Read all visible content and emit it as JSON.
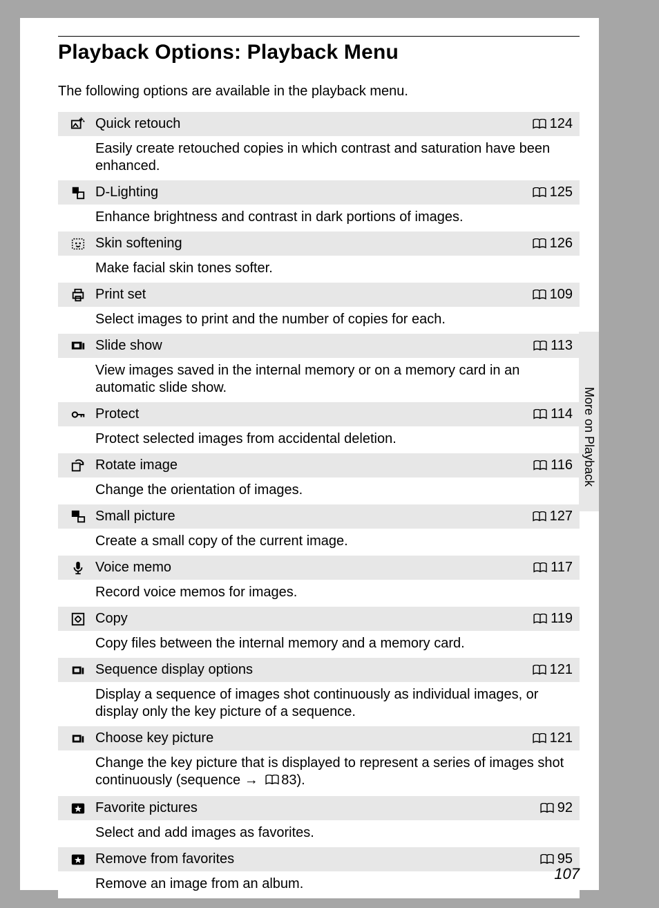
{
  "page_title": "Playback Options: Playback Menu",
  "intro": "The following options are available in the playback menu.",
  "side_label": "More on Playback",
  "page_number": "107",
  "items": [
    {
      "icon": "retouch",
      "title": "Quick retouch",
      "page": "124",
      "desc": "Easily create retouched copies in which contrast and saturation have been enhanced."
    },
    {
      "icon": "dlight",
      "title": "D-Lighting",
      "page": "125",
      "desc": "Enhance brightness and contrast in dark portions of images."
    },
    {
      "icon": "face",
      "title": "Skin softening",
      "page": "126",
      "desc": "Make facial skin tones softer."
    },
    {
      "icon": "printer",
      "title": "Print set",
      "page": "109",
      "desc": "Select images to print and the number of copies for each."
    },
    {
      "icon": "slideshow",
      "title": "Slide show",
      "page": "113",
      "desc": "View images saved in the internal memory or on a memory card in an automatic slide show."
    },
    {
      "icon": "key",
      "title": "Protect",
      "page": "114",
      "desc": "Protect selected images from accidental deletion."
    },
    {
      "icon": "rotate",
      "title": "Rotate image",
      "page": "116",
      "desc": "Change the orientation of images."
    },
    {
      "icon": "small",
      "title": "Small picture",
      "page": "127",
      "desc": "Create a small copy of the current image."
    },
    {
      "icon": "mic",
      "title": "Voice memo",
      "page": "117",
      "desc": "Record voice memos for images."
    },
    {
      "icon": "copy",
      "title": "Copy",
      "page": "119",
      "desc": "Copy files between the internal memory and a memory card."
    },
    {
      "icon": "sequence",
      "title": "Sequence display options",
      "page": "121",
      "desc": "Display a sequence of images shot continuously as individual images, or display only the key picture of a sequence."
    },
    {
      "icon": "sequence",
      "title": "Choose key picture",
      "page": "121",
      "desc_pre": "Change the key picture that is displayed to represent a series of images shot continuously (sequence → ",
      "desc_ref": "83",
      "desc_post": ")."
    },
    {
      "icon": "star",
      "title": "Favorite pictures",
      "page": "92",
      "desc": "Select and add images as favorites."
    },
    {
      "icon": "star",
      "title": "Remove from favorites",
      "page": "95",
      "desc": "Remove an image from an album."
    }
  ]
}
